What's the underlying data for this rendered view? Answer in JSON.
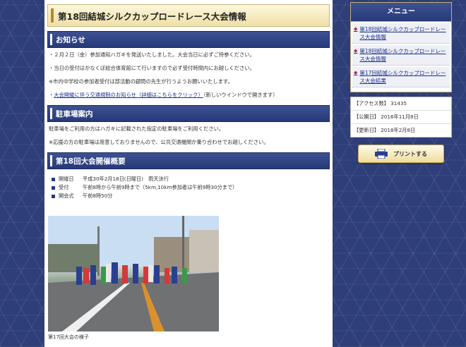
{
  "page": {
    "title": "第18回結城シルクカップロードレース大会情報"
  },
  "notice": {
    "heading": "お知らせ",
    "lines": [
      "・２月２日（金）参加通知ハガキを発送いたしました。大会当日に必ずご持参ください。",
      "・当日の受付はかなくぼ総合体育館にて行いますので必ず受付時間内にお越しください。",
      "※市内中学校の参加者受付は部活動の顧問の先生が行うようお願いいたします。"
    ],
    "link_prefix": "・",
    "link_text": "大会開催に伴う交通規制のお知らせ（詳細はこちらをクリック）",
    "link_suffix": "（新しいウインドウで開きます）"
  },
  "parking": {
    "heading": "駐車場案内",
    "lines": [
      "駐車場をご利用の方はハガキに記載された指定の駐車場をご利用ください。",
      "※応援の方の駐車場は用意しておりませんので、公共交通機関か乗り合わせでお越しください。"
    ]
  },
  "overview": {
    "heading": "第18回大会開催概要",
    "items": [
      {
        "key": "開催日",
        "value": "平成30年2月18日(日曜日)　雨天決行"
      },
      {
        "key": "受付",
        "value": "午前8時から午前9時まで（5km,10km参加者は午前9時30分まで）"
      },
      {
        "key": "開会式",
        "value": "午前8時50分"
      }
    ],
    "photo_caption": "第17回大会の様子"
  },
  "sidebar": {
    "menu_title": "メニュー",
    "menu_items": [
      "第18回結城シルクカップロードレース大会情報",
      "第18回結城シルクカップロードレース大会情報",
      "第17回結城シルクカップロードレース大会結果"
    ],
    "info": [
      "【アクセス数】 31435",
      "【公開日】 2016年11月8日",
      "【更新日】 2018年2月8日"
    ],
    "print_label": "プリントする"
  },
  "colors": {
    "accent_navy": "#263a7a",
    "link": "#1b2f8f",
    "gold_border": "#c8b06a"
  }
}
